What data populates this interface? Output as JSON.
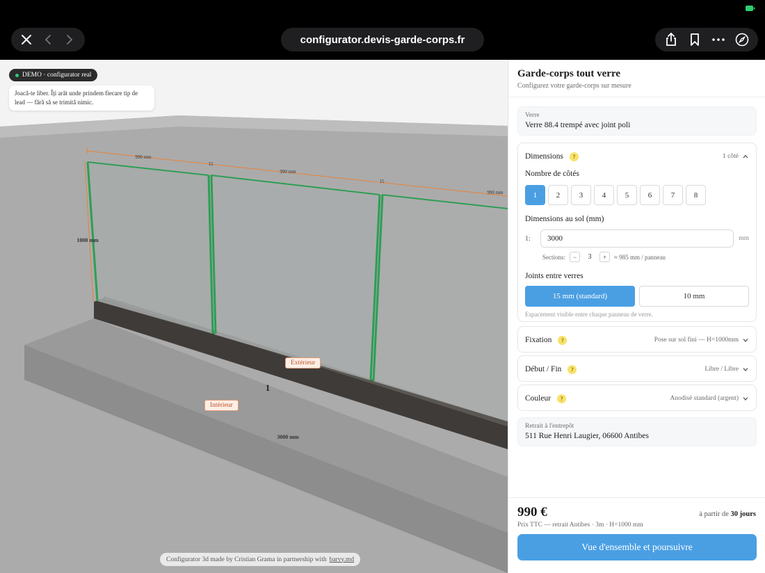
{
  "browser": {
    "url": "configurator.devis-garde-corps.fr"
  },
  "viewport": {
    "demo_badge": "DEMO · configurator real",
    "demo_note": "Joacă-te liber. Îți arăt unde prindem fiecare tip de lead — fără să se trimită nimic.",
    "dim_width_1": "990 mm",
    "dim_width_2": "990 mm",
    "dim_width_3": "990 mm",
    "gap_1": "15",
    "gap_2": "15",
    "dim_height": "1000 mm",
    "label_exterior": "Extérieur",
    "label_interior": "Intérieur",
    "side_number": "1",
    "dim_total": "3000 mm",
    "credit_text": "Configurator 3d made by Cristian Grama in partnership with",
    "credit_link": "barvy.md"
  },
  "panel": {
    "title": "Garde-corps tout verre",
    "subtitle": "Configurez votre garde-corps sur mesure",
    "glass": {
      "label": "Verre",
      "value": "Verre 88.4 trempé avec joint poli"
    },
    "dimensions": {
      "title": "Dimensions",
      "help": "?",
      "summary": "1 côté",
      "sides_label": "Nombre de côtés",
      "sides": [
        "1",
        "2",
        "3",
        "4",
        "5",
        "6",
        "7",
        "8"
      ],
      "sides_selected": "1",
      "floor_label": "Dimensions au sol (mm)",
      "side_index": "1:",
      "length_value": "3000",
      "unit": "mm",
      "sections_label": "Sections:",
      "sections_minus": "−",
      "sections_value": "3",
      "sections_plus": "+",
      "sections_hint": "≈ 985 mm / panneau",
      "joints_label": "Joints entre verres",
      "joint_standard": "15 mm (standard)",
      "joint_alt": "10 mm",
      "joints_hint": "Espacement visible entre chaque panneau de verre."
    },
    "fixation": {
      "title": "Fixation",
      "help": "?",
      "value": "Pose sur sol fini — H=1000mm"
    },
    "debut_fin": {
      "title": "Début / Fin",
      "help": "?",
      "value": "Libre / Libre"
    },
    "couleur": {
      "title": "Couleur",
      "help": "?",
      "value": "Anodisé standard (argent)"
    },
    "pickup": {
      "label": "Retrait à l'entrepôt",
      "value": "511 Rue Henri Laugier, 06600 Antibes"
    },
    "footer": {
      "price": "990 €",
      "price_sub": "Prix TTC — retrait Antibes · 3m · H=1000 mm",
      "delivery_prefix": "à partir de",
      "delivery_days": "30 jours",
      "cta": "Vue d'ensemble et poursuivre"
    }
  },
  "colors": {
    "accent": "#4a9fe3",
    "glass_edge": "#2e9e55",
    "dimension_line": "#e8833a",
    "tag_text": "#c0502a",
    "help_badge": "#f7e26b"
  }
}
